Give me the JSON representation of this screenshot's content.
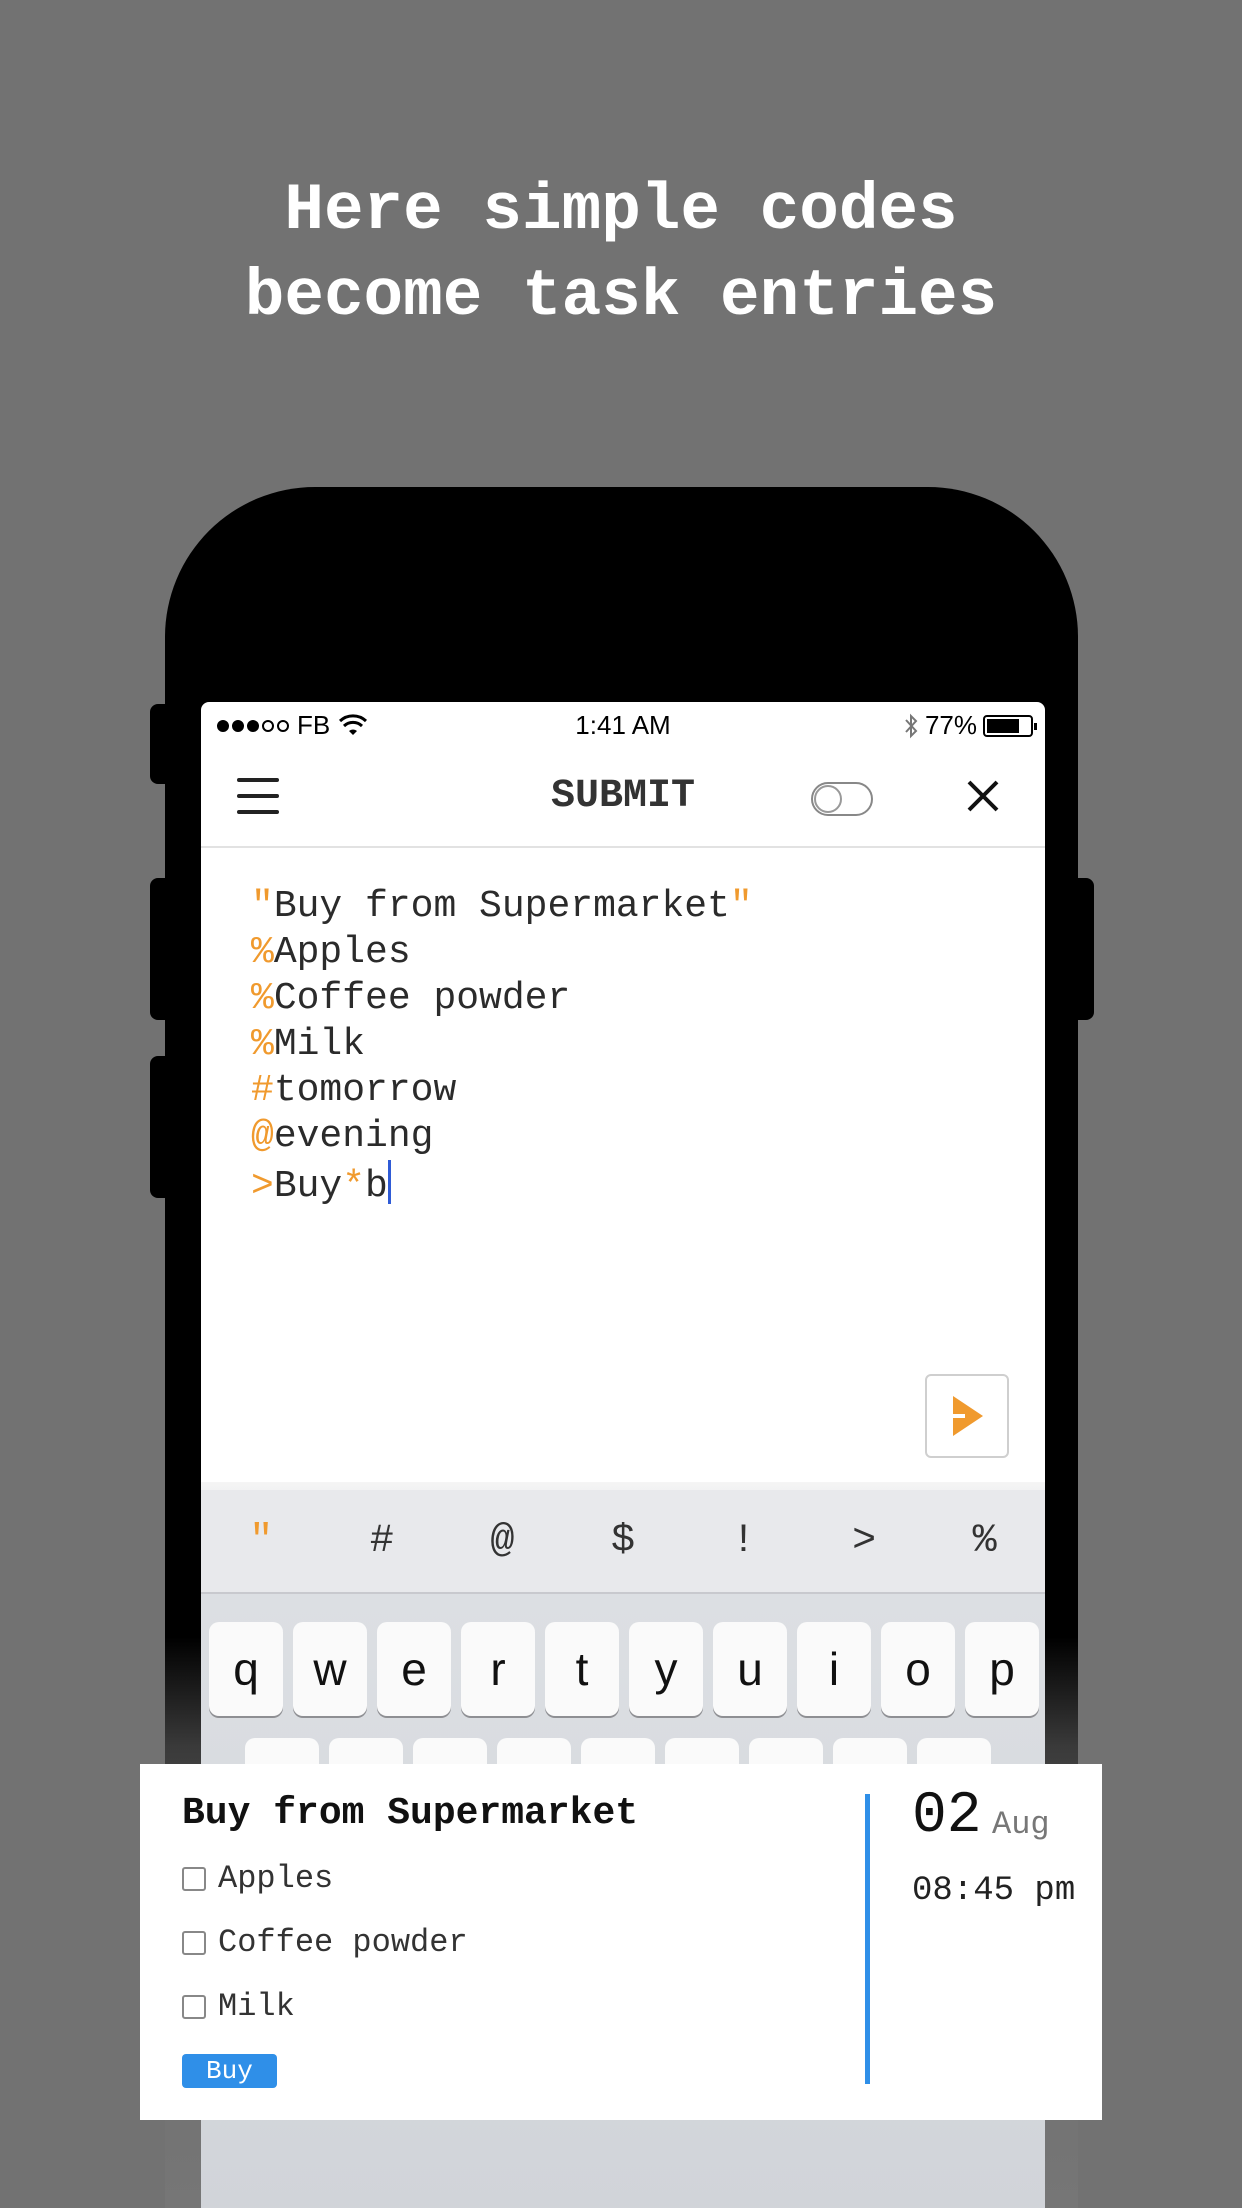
{
  "headline": {
    "line1": "Here simple codes",
    "line2": "become task entries"
  },
  "statusbar": {
    "carrier": "FB",
    "time": "1:41 AM",
    "battery": "77%"
  },
  "navbar": {
    "title": "SUBMIT"
  },
  "editor": {
    "lines": [
      {
        "prefix": "\"",
        "text": "Buy from Supermarket",
        "suffix": "\""
      },
      {
        "prefix": "%",
        "text": "Apples"
      },
      {
        "prefix": "%",
        "text": "Coffee powder"
      },
      {
        "prefix": "%",
        "text": "Milk"
      },
      {
        "prefix": "#",
        "text": "tomorrow"
      },
      {
        "prefix": "@",
        "text": "evening"
      },
      {
        "prefix": ">",
        "text": "Buy",
        "mid": "*",
        "tail": "b"
      }
    ]
  },
  "shortcuts": [
    "\"",
    "#",
    "@",
    "$",
    "!",
    ">",
    "%"
  ],
  "keyboard": {
    "row1": [
      "q",
      "w",
      "e",
      "r",
      "t",
      "y",
      "u",
      "i",
      "o",
      "p"
    ]
  },
  "card": {
    "title": "Buy from Supermarket",
    "items": [
      "Apples",
      "Coffee powder",
      "Milk"
    ],
    "tag": "Buy",
    "day": "02",
    "month": "Aug",
    "time": "08:45 pm"
  },
  "colors": {
    "accent": "#f09a2e",
    "blue": "#2f8fe8",
    "background": "#727272"
  }
}
